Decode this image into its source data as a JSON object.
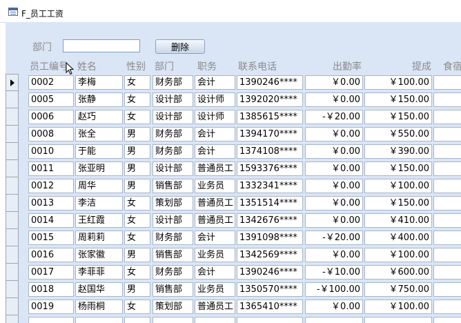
{
  "window": {
    "title": "F_员工工资"
  },
  "filter": {
    "dept_label": "部门",
    "dept_value": "",
    "delete_label": "删除"
  },
  "columns": {
    "emp_id": "员工编号",
    "name": "姓名",
    "gender": "性别",
    "dept": "部门",
    "position": "职务",
    "phone": "联系电话",
    "attendance": "出勤率",
    "commission": "提成",
    "meal": "食宿"
  },
  "rows": [
    {
      "id": "0002",
      "name": "李梅",
      "gender": "女",
      "dept": "财务部",
      "pos": "会计",
      "phone": "1390246****",
      "att": "￥0.00",
      "comm": "￥100.00"
    },
    {
      "id": "0005",
      "name": "张静",
      "gender": "女",
      "dept": "设计部",
      "pos": "设计师",
      "phone": "1392020****",
      "att": "￥0.00",
      "comm": "￥150.00"
    },
    {
      "id": "0006",
      "name": "赵巧",
      "gender": "女",
      "dept": "设计部",
      "pos": "设计师",
      "phone": "1385615****",
      "att": "-￥20.00",
      "comm": "￥150.00"
    },
    {
      "id": "0008",
      "name": "张全",
      "gender": "男",
      "dept": "财务部",
      "pos": "会计",
      "phone": "1394170****",
      "att": "￥0.00",
      "comm": "￥550.00"
    },
    {
      "id": "0010",
      "name": "于能",
      "gender": "男",
      "dept": "财务部",
      "pos": "会计",
      "phone": "1374108****",
      "att": "￥0.00",
      "comm": "￥390.00"
    },
    {
      "id": "0011",
      "name": "张亚明",
      "gender": "男",
      "dept": "设计部",
      "pos": "普通员工",
      "phone": "1593376****",
      "att": "￥0.00",
      "comm": "￥150.00"
    },
    {
      "id": "0012",
      "name": "周华",
      "gender": "男",
      "dept": "销售部",
      "pos": "业务员",
      "phone": "1332341****",
      "att": "￥0.00",
      "comm": "￥100.00"
    },
    {
      "id": "0013",
      "name": "李洁",
      "gender": "女",
      "dept": "策划部",
      "pos": "普通员工",
      "phone": "1351514****",
      "att": "￥0.00",
      "comm": "￥150.00"
    },
    {
      "id": "0014",
      "name": "王红霞",
      "gender": "女",
      "dept": "设计部",
      "pos": "普通员工",
      "phone": "1342676****",
      "att": "￥0.00",
      "comm": "￥410.00"
    },
    {
      "id": "0015",
      "name": "周莉莉",
      "gender": "女",
      "dept": "财务部",
      "pos": "会计",
      "phone": "1391098****",
      "att": "-￥20.00",
      "comm": "￥400.00"
    },
    {
      "id": "0016",
      "name": "张家徽",
      "gender": "男",
      "dept": "销售部",
      "pos": "业务员",
      "phone": "1342569****",
      "att": "￥0.00",
      "comm": "￥100.00"
    },
    {
      "id": "0017",
      "name": "李菲菲",
      "gender": "女",
      "dept": "财务部",
      "pos": "会计",
      "phone": "1390246****",
      "att": "-￥10.00",
      "comm": "￥600.00"
    },
    {
      "id": "0018",
      "name": "赵国华",
      "gender": "男",
      "dept": "销售部",
      "pos": "业务员",
      "phone": "1350570****",
      "att": "-￥100.00",
      "comm": "￥750.00"
    },
    {
      "id": "0019",
      "name": "杨雨桐",
      "gender": "女",
      "dept": "策划部",
      "pos": "普通员工",
      "phone": "1365410****",
      "att": "￥0.00",
      "comm": "￥100.00"
    },
    {
      "id": "",
      "name": "",
      "gender": "",
      "dept": "",
      "pos": "",
      "phone": "",
      "att": "",
      "comm": ""
    }
  ],
  "colors": {
    "form_bg": "#dae6f6",
    "label": "#8a8a8a",
    "cell_border": "#a7b5c8"
  }
}
